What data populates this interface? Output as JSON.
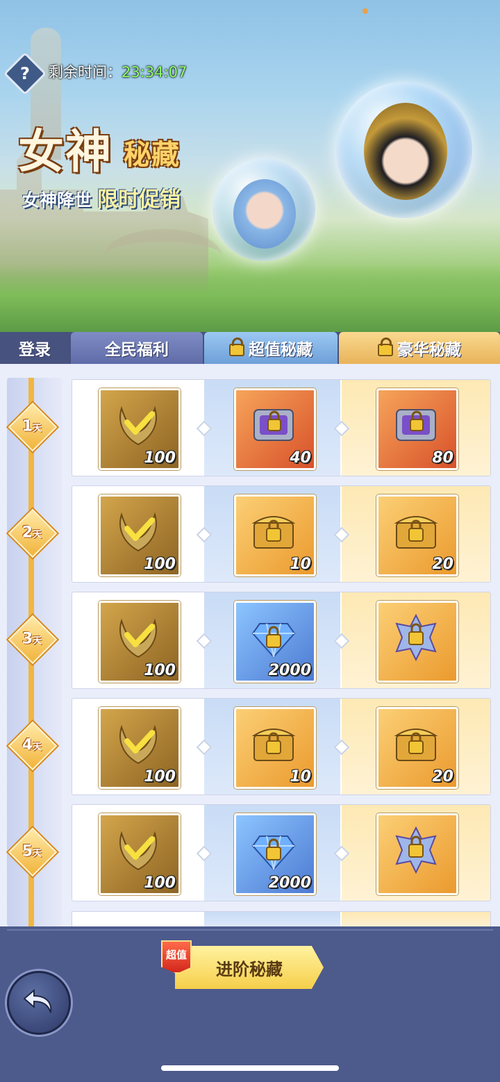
{
  "header": {
    "timer_label": "剩余时间：",
    "timer_value": "23:34:07",
    "title_big": "女神",
    "title_small": "秘藏",
    "subtitle": "女神降世",
    "subtitle_highlight": "限时促销"
  },
  "tabs": [
    {
      "label": "登录"
    },
    {
      "label": "全民福利"
    },
    {
      "label": "超值秘藏"
    },
    {
      "label": "豪华秘藏"
    }
  ],
  "rows": [
    {
      "day": "1",
      "day_unit": "天",
      "free": "100",
      "super": "40",
      "super_icon": "gem-cube-chest-icon",
      "lux": "80",
      "lux_icon": "gem-cube-chest-icon"
    },
    {
      "day": "2",
      "day_unit": "天",
      "free": "100",
      "super": "10",
      "super_icon": "treasure-chest-icon",
      "lux": "20",
      "lux_icon": "treasure-chest-icon"
    },
    {
      "day": "3",
      "day_unit": "天",
      "free": "100",
      "super": "2000",
      "super_icon": "diamond-icon",
      "lux": "",
      "lux_icon": "star-crystal-icon"
    },
    {
      "day": "4",
      "day_unit": "天",
      "free": "100",
      "super": "10",
      "super_icon": "treasure-chest-icon",
      "lux": "20",
      "lux_icon": "treasure-chest-icon"
    },
    {
      "day": "5",
      "day_unit": "天",
      "free": "100",
      "super": "2000",
      "super_icon": "diamond-icon",
      "lux": "",
      "lux_icon": "star-crystal-icon"
    }
  ],
  "footer": {
    "badge": "超值",
    "advance_button": "进阶秘藏"
  },
  "colors": {
    "timer_value": "#8fff6a",
    "progress_rail": "#f2b640",
    "background": "#4d5a8c"
  }
}
